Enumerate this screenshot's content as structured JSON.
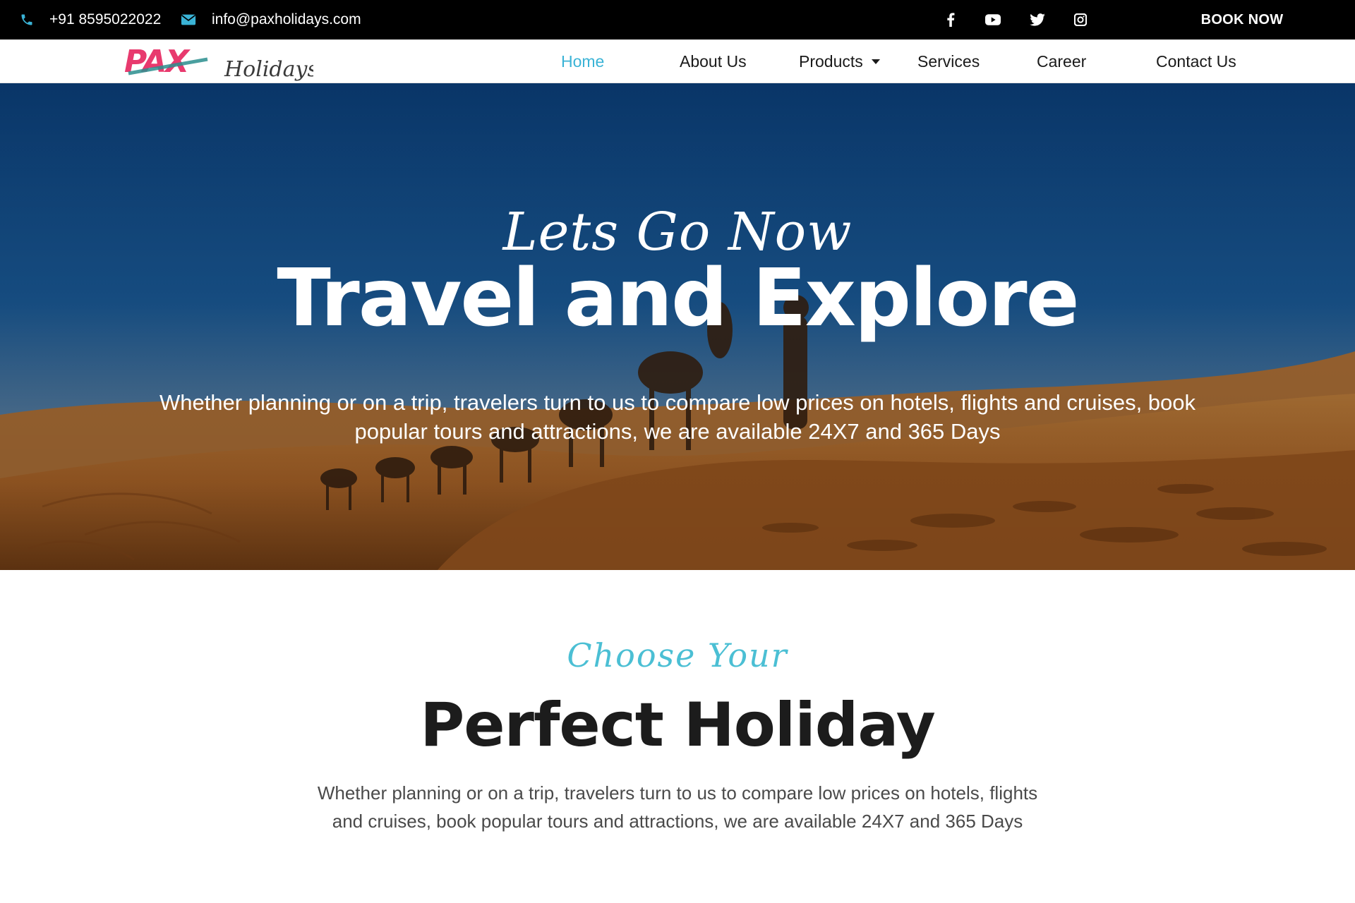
{
  "topbar": {
    "phone": "+91 8595022022",
    "email": "info@paxholidays.com",
    "social_icons": [
      "facebook-icon",
      "youtube-icon",
      "twitter-icon",
      "instagram-icon"
    ],
    "book_now": "BOOK NOW"
  },
  "brand": {
    "logo_mark": "PAX",
    "logo_text": "Holidays",
    "mark_color": "#e83a6e",
    "accent_color": "#3ab3d6"
  },
  "nav": {
    "items": [
      {
        "label": "Home",
        "active": true
      },
      {
        "label": "About Us"
      },
      {
        "label": "Products",
        "dropdown": true
      },
      {
        "label": "Services"
      },
      {
        "label": "Career"
      },
      {
        "label": "Contact Us"
      }
    ]
  },
  "hero": {
    "script": "Lets Go Now",
    "headline": "Travel and Explore",
    "description": "Whether planning or on a trip, travelers turn to us to compare low prices on hotels, flights and cruises, book popular tours and attractions, we are available 24X7 and 365 Days"
  },
  "section": {
    "script": "Choose Your",
    "title": "Perfect Holiday",
    "description": "Whether planning or on a trip, travelers turn to us to compare low prices on hotels, flights and cruises, book popular tours and attractions, we are available 24X7 and 365 Days"
  }
}
